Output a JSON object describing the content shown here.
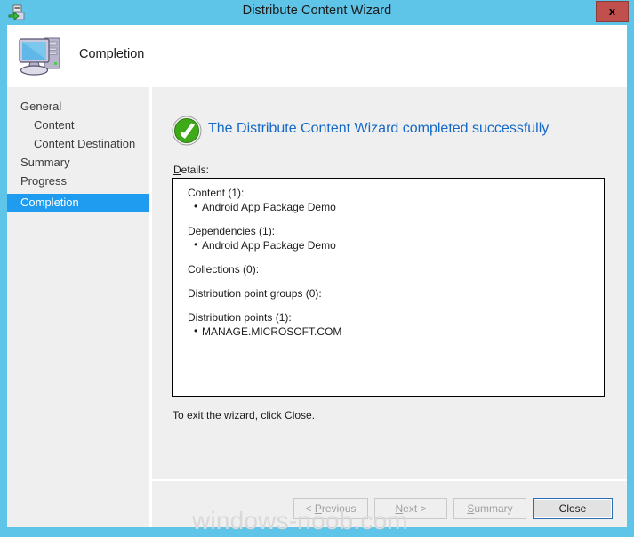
{
  "window": {
    "title": "Distribute Content Wizard",
    "title_icon": "distribute-content-icon",
    "close_label": "x",
    "frame_color": "#5EC5E8"
  },
  "header": {
    "icon": "computer-icon",
    "title": "Completion"
  },
  "sidebar": {
    "items": [
      {
        "label": "General",
        "level": 0,
        "selected": false
      },
      {
        "label": "Content",
        "level": 1,
        "selected": false
      },
      {
        "label": "Content Destination",
        "level": 1,
        "selected": false
      },
      {
        "label": "Summary",
        "level": 0,
        "selected": false
      },
      {
        "label": "Progress",
        "level": 0,
        "selected": false
      },
      {
        "label": "Completion",
        "level": 0,
        "selected": true
      }
    ],
    "selected_color": "#1F9BF0"
  },
  "main": {
    "status_icon": "success-check-icon",
    "status_text": "The Distribute Content Wizard completed successfully",
    "status_color": "#1569C7",
    "details_label": "Details:",
    "details_accesskey": "D",
    "details": [
      {
        "heading": "Content (1):",
        "items": [
          "Android App Package Demo"
        ]
      },
      {
        "heading": "Dependencies (1):",
        "items": [
          "Android App Package Demo"
        ]
      },
      {
        "heading": "Collections (0):",
        "items": []
      },
      {
        "heading": "Distribution point groups (0):",
        "items": []
      },
      {
        "heading": "Distribution points (1):",
        "items": [
          "MANAGE.MICROSOFT.COM"
        ]
      }
    ],
    "exit_note": "To exit the wizard, click Close."
  },
  "footer": {
    "buttons": [
      {
        "label": "< Previous",
        "accesskey": "P",
        "enabled": false
      },
      {
        "label": "Next >",
        "accesskey": "N",
        "enabled": false
      },
      {
        "label": "Summary",
        "accesskey": "S",
        "enabled": false
      },
      {
        "label": "Close",
        "accesskey": "",
        "enabled": true
      }
    ]
  },
  "watermark": {
    "text": "windows-noob.com"
  }
}
